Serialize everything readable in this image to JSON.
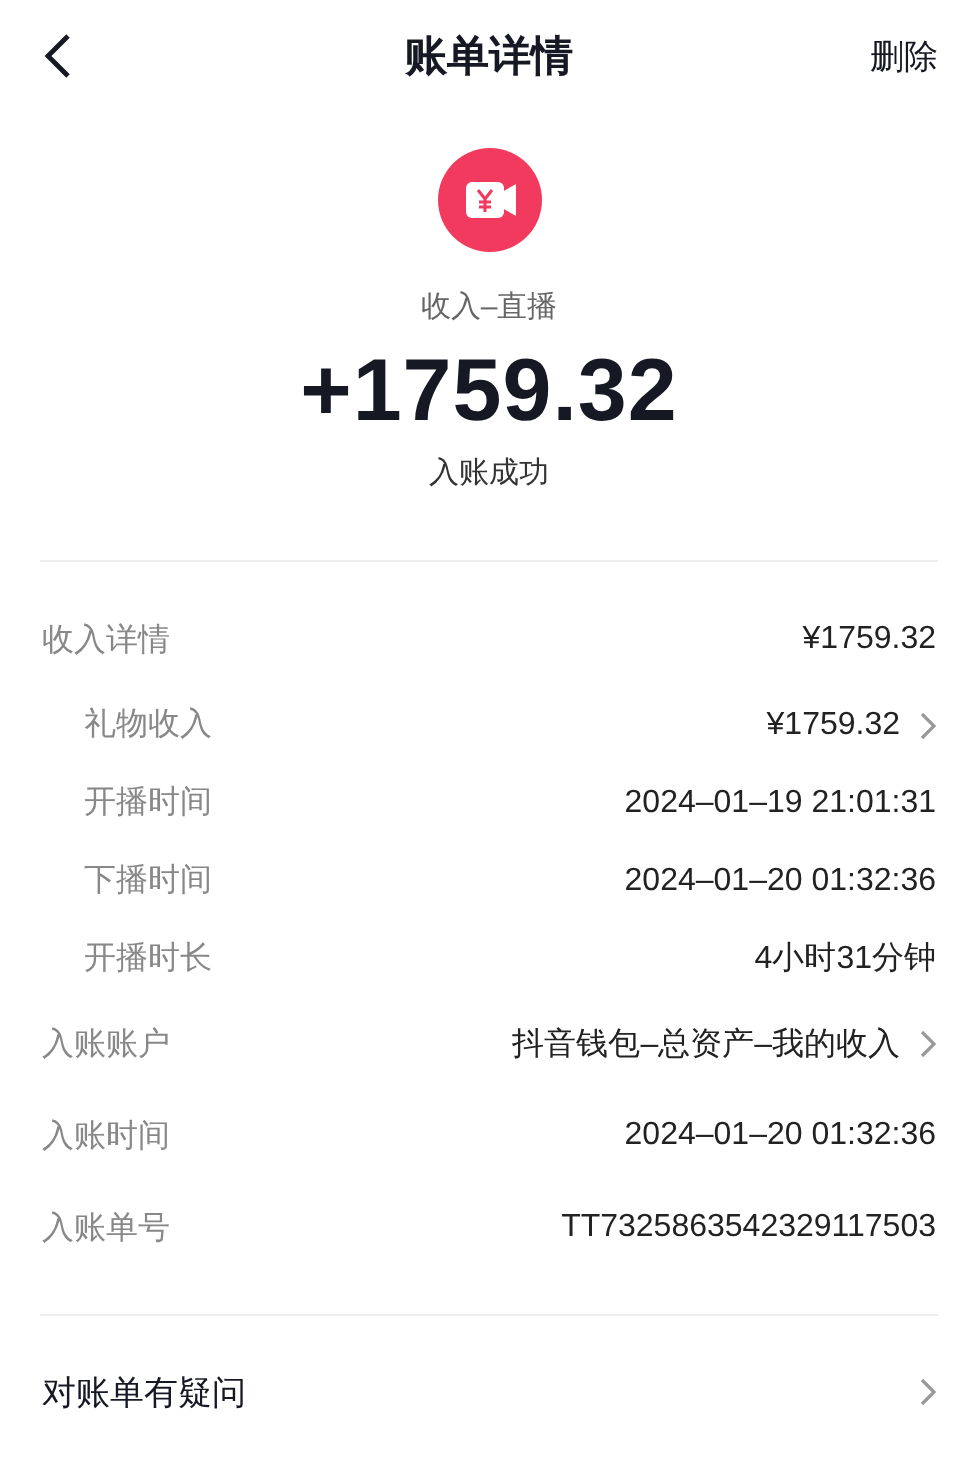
{
  "header": {
    "title": "账单详情",
    "action": "删除"
  },
  "summary": {
    "category": "收入–直播",
    "amount": "+1759.32",
    "status": "入账成功"
  },
  "details": [
    {
      "kind": "main",
      "label": "收入详情",
      "value": "¥1759.32",
      "link": false
    },
    {
      "kind": "sub",
      "label": "礼物收入",
      "value": "¥1759.32",
      "link": true
    },
    {
      "kind": "sub",
      "label": "开播时间",
      "value": "2024–01–19 21:01:31",
      "link": false
    },
    {
      "kind": "sub",
      "label": "下播时间",
      "value": "2024–01–20 01:32:36",
      "link": false
    },
    {
      "kind": "sub",
      "label": "开播时长",
      "value": "4小时31分钟",
      "link": false
    },
    {
      "kind": "main",
      "label": "入账账户",
      "value": "抖音钱包–总资产–我的收入",
      "link": true
    },
    {
      "kind": "main",
      "label": "入账时间",
      "value": "2024–01–20 01:32:36",
      "link": false
    },
    {
      "kind": "main",
      "label": "入账单号",
      "value": "TT7325863542329117503",
      "link": false
    }
  ],
  "footer": {
    "label": "对账单有疑问"
  }
}
